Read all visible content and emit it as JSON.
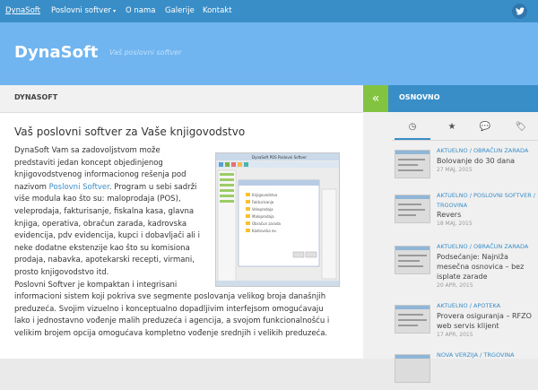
{
  "nav": {
    "items": [
      {
        "label": "DynaSoft"
      },
      {
        "label": "Poslovni softver",
        "caret": "▾"
      },
      {
        "label": "O nama"
      },
      {
        "label": "Galerije"
      },
      {
        "label": "Kontakt"
      }
    ],
    "twitter_icon": "twitter-icon"
  },
  "header": {
    "brand": "DynaSoft",
    "tagline": "Vaš poslovni softver"
  },
  "breadcrumb": "DYNASOFT",
  "article": {
    "title": "Vaš poslovni softver za Vaše knjigovodstvo",
    "lines": [
      {
        "text": "DynaSoft Vam sa zadovoljstvom može"
      },
      {
        "text": "predstaviti jedan koncept objedinjenog"
      },
      {
        "text": "knjigovodstvenog informacionog rešenja pod"
      },
      {
        "pre": "nazivom ",
        "link": "Poslovni Softver",
        "post": ". Program u sebi sadrži"
      },
      {
        "text": "više modula kao što su: maloprodaja (POS),"
      },
      {
        "text": "veleprodaja, fakturisanje, fiskalna kasa, glavna"
      },
      {
        "text": "knjiga, operativa, obračun zarada, kadrovska"
      },
      {
        "text": "evidencija, pdv evidencija, kupci i dobavljači ali i"
      },
      {
        "text": "neke dodatne ekstenzije kao što su komisiona"
      },
      {
        "text": "prodaja, nabavka, apotekarski recepti, virmani,"
      },
      {
        "text": "prosto knjigovodstvo itd."
      }
    ],
    "paragraph2": [
      "Poslovni Softver je kompaktan i integrisani",
      "informacioni sistem koji pokriva sve segmente poslovanja velikog broja današnjih",
      "preduzeća. Svojim vizuelno i konceptualno dopadljivim interfejsom omogućavaju",
      "lako i jednostavno vođenje malih preduzeća i agencija, a svojom funkcionalnošću i",
      "velikim brojem opcija omogućava kompletno vođenje srednjih i velikih preduzeća."
    ],
    "screenshot": {
      "window_title": "DynaSoft POS Poslovni Softver",
      "tree_items": [
        "Knjigovodstvo",
        "Fakturisanje",
        "Veleprodaja",
        "Maloprodaja",
        "Obračun zarada",
        "Kadrovska ev."
      ]
    }
  },
  "sidebar": {
    "title": "OSNOVNO",
    "toggle_icon": "double-chevron-left-icon",
    "tabs": [
      {
        "name": "clock-icon",
        "glyph": "◷"
      },
      {
        "name": "star-icon",
        "glyph": "★"
      },
      {
        "name": "comments-icon",
        "glyph": "💬"
      },
      {
        "name": "tags-icon",
        "glyph": "🏷"
      }
    ],
    "posts": [
      {
        "category": "AKTUELNO / OBRAČUN ZARADA",
        "title": "Bolovanje do 30 dana",
        "date": "27 MAJ, 2015"
      },
      {
        "category": "AKTUELNO / POSLOVNI SOFTVER / TRGOVINA",
        "title": "Revers",
        "date": "18 MAJ, 2015"
      },
      {
        "category": "AKTUELNO / OBRAČUN ZARADA",
        "title": "Podsećanje: Najniža mesečna osnovica – bez isplate zarade",
        "date": "20 APR, 2015"
      },
      {
        "category": "AKTUELNO / APOTEKA",
        "title": "Provera osiguranja – RFZO web servis klijent",
        "date": "17 APR, 2015"
      },
      {
        "category": "NOVA VERZIJA / TRGOVINA",
        "title": "",
        "date": ""
      }
    ]
  }
}
